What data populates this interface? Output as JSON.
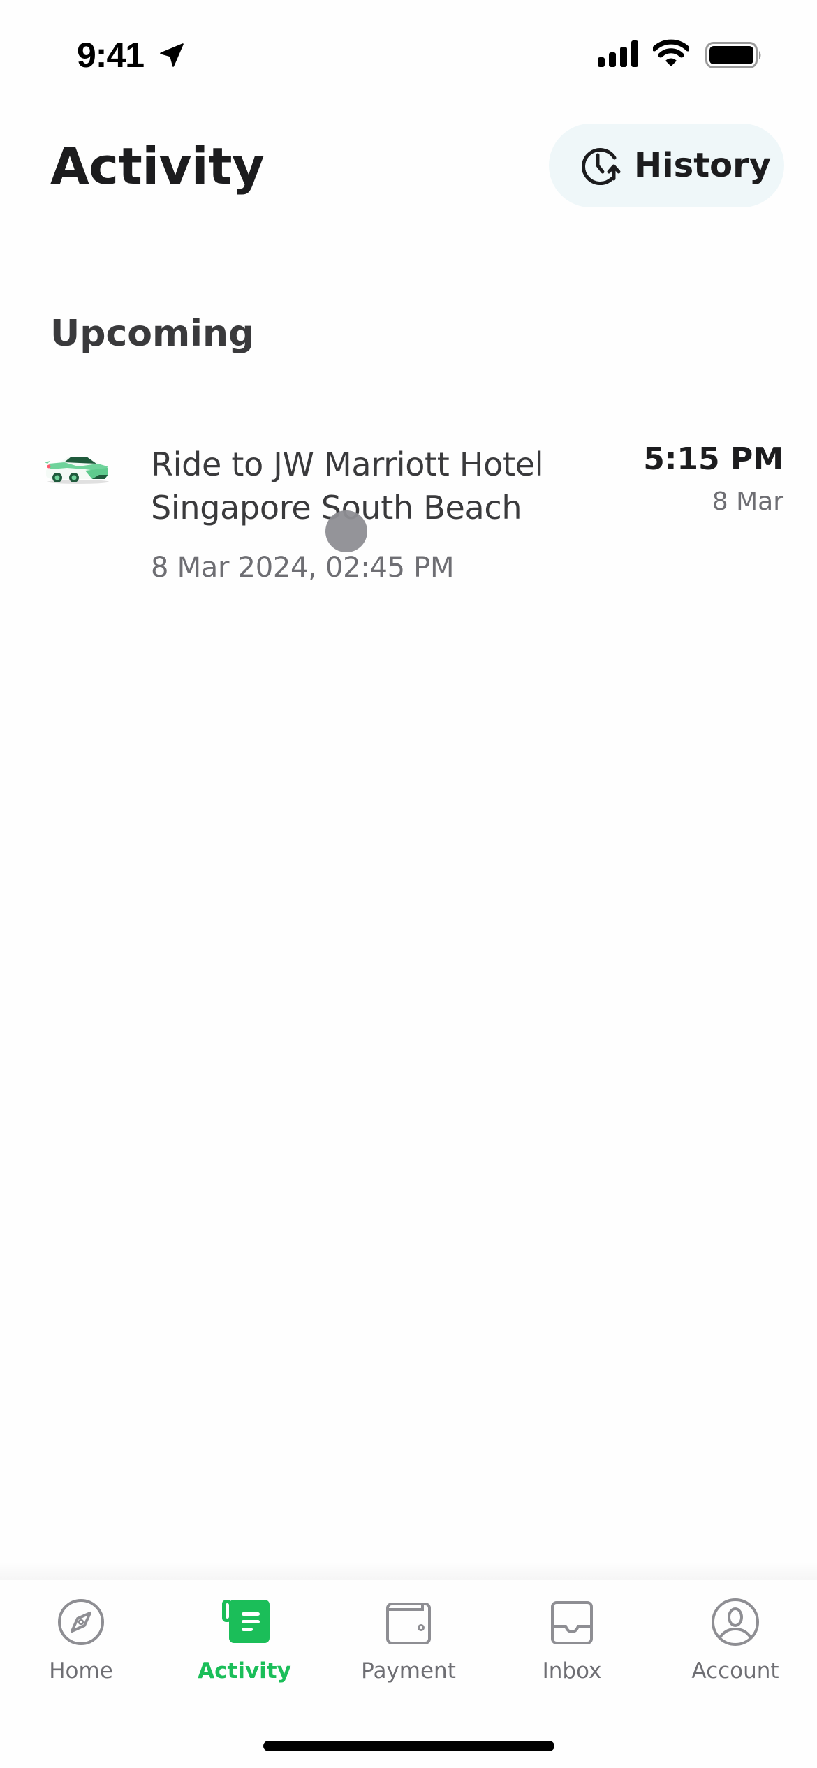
{
  "status_bar": {
    "time": "9:41",
    "icons": [
      "location-arrow-icon",
      "cellular-signal-icon",
      "wifi-icon",
      "battery-icon"
    ]
  },
  "header": {
    "title": "Activity",
    "history_button": {
      "label": "History",
      "icon": "history-clock-icon"
    }
  },
  "upcoming": {
    "section_title": "Upcoming",
    "items": [
      {
        "icon": "car-icon",
        "title": "Ride to JW Marriott Hotel Singapore South Beach",
        "booked_datetime": "8 Mar 2024, 02:45 PM",
        "pickup_time": "5:15 PM",
        "pickup_date": "8 Mar"
      }
    ]
  },
  "tab_bar": {
    "active": "Activity",
    "accent_color": "#1bbe59",
    "inactive_color": "#8e8e93",
    "tabs": [
      {
        "label": "Home",
        "icon": "compass-icon"
      },
      {
        "label": "Activity",
        "icon": "activity-list-icon"
      },
      {
        "label": "Payment",
        "icon": "wallet-icon"
      },
      {
        "label": "Inbox",
        "icon": "inbox-tray-icon"
      },
      {
        "label": "Account",
        "icon": "account-user-icon"
      }
    ]
  }
}
